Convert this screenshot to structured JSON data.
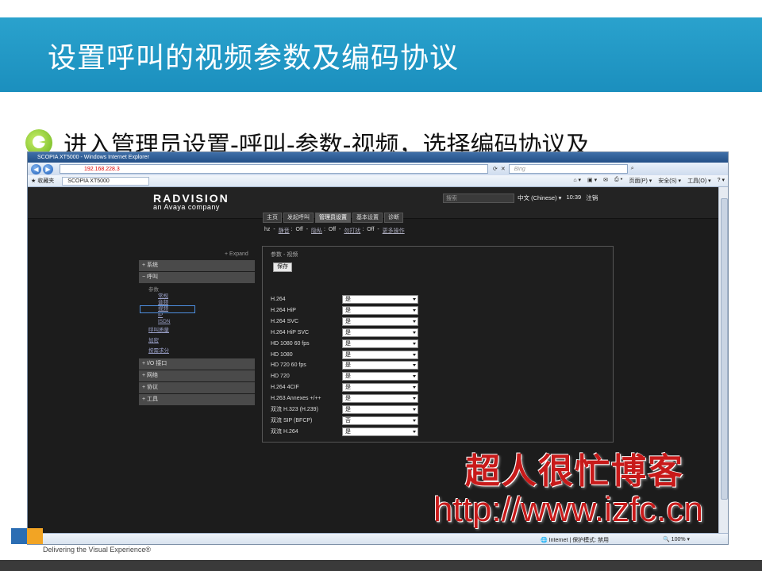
{
  "slide": {
    "title": "设置呼叫的视频参数及编码协议",
    "bullet": "进入管理员设置-呼叫-参数-视频，选择编码协议及",
    "logo_tagline": "Delivering the Visual Experience®"
  },
  "browser": {
    "window_title": "SCOPIA XT5000 - Windows Internet Explorer",
    "address": "192.168.228.3",
    "bing_placeholder": "Bing",
    "favorites_label": "收藏夹",
    "tab_label": "SCOPIA XT5000",
    "toolbar_items": [
      "页面(P) ▾",
      "安全(S) ▾",
      "工具(O) ▾"
    ],
    "status_zone": "Internet | 保护模式: 禁用",
    "zoom": "100%"
  },
  "app": {
    "brand_name": "RADVISION",
    "brand_sub": "an Avaya company",
    "search_placeholder": "搜索",
    "language": "中文 (Chinese) ▾",
    "time": "10:39",
    "logout": "注销",
    "main_tabs": [
      "主页",
      "发起呼叫",
      "管理员设置",
      "基本设置",
      "诊断"
    ],
    "active_tab": "管理员设置",
    "status": {
      "name": "hz",
      "items": [
        {
          "label": "静音",
          "value": "Off"
        },
        {
          "label": "隐私",
          "value": "Off"
        },
        {
          "label": "勿打扰",
          "value": "Off"
        }
      ],
      "more": "更多操作"
    },
    "expand_label": "+ Expand",
    "side_menu": {
      "system": "+ 系统",
      "call": "− 呼叫",
      "params_head": "参数",
      "params_links": [
        "常规",
        "音频",
        "视频",
        "IP",
        "ISDN"
      ],
      "selected": "视频",
      "call_links": [
        "呼叫质量",
        "加密",
        "按需求分"
      ],
      "io": "+ I/O 接口",
      "network": "+ 网络",
      "protocol": "+ 协议",
      "tools": "+ 工具"
    },
    "panel": {
      "breadcrumb": "参数 - 视频",
      "save_label": "保存",
      "rows": [
        {
          "label": "H.264",
          "value": "是"
        },
        {
          "label": "H.264 HiP",
          "value": "是"
        },
        {
          "label": "H.264 SVC",
          "value": "是"
        },
        {
          "label": "H.264 HiP SVC",
          "value": "是"
        },
        {
          "label": "HD 1080 60 fps",
          "value": "是"
        },
        {
          "label": "HD 1080",
          "value": "是"
        },
        {
          "label": "HD 720 60 fps",
          "value": "是"
        },
        {
          "label": "HD 720",
          "value": "是"
        },
        {
          "label": "H.264 4CIF",
          "value": "是"
        },
        {
          "label": "H.263 Annexes +/++",
          "value": "是"
        },
        {
          "label": "双流 H.323 (H.239)",
          "value": "是"
        },
        {
          "label": "双流 SIP (BFCP)",
          "value": "否"
        },
        {
          "label": "双流 H.264",
          "value": "是"
        }
      ]
    }
  },
  "watermark": {
    "line1": "超人很忙博客",
    "line2": "http://www.izfc.cn"
  }
}
